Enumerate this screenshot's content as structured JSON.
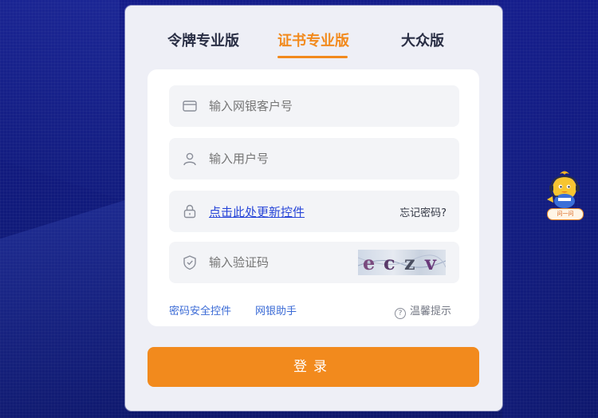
{
  "tabs": [
    {
      "label": "令牌专业版",
      "active": false
    },
    {
      "label": "证书专业版",
      "active": true
    },
    {
      "label": "大众版",
      "active": false
    }
  ],
  "form": {
    "customer_no_placeholder": "输入网银客户号",
    "user_no_placeholder": "输入用户号",
    "update_control_link": "点击此处更新控件",
    "forgot_password": "忘记密码?",
    "captcha_placeholder": "输入验证码",
    "captcha_text": "eczv"
  },
  "links": {
    "password_control": "密码安全控件",
    "bank_assistant": "网银助手",
    "tips": "温馨提示"
  },
  "login_button": "登录",
  "mascot": {
    "label": "问一问"
  },
  "colors": {
    "accent": "#f28a1d",
    "background": "#121b82",
    "link": "#3b6bd6"
  },
  "icons": [
    "card-icon",
    "user-icon",
    "lock-icon",
    "shield-icon",
    "question-icon"
  ]
}
